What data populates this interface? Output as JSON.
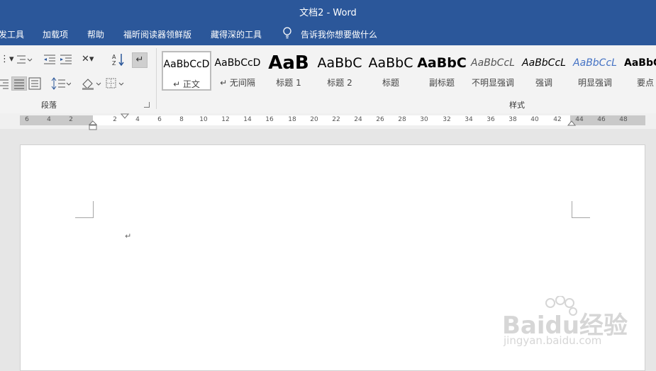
{
  "title": "文档2  -  Word",
  "menu": [
    "发工具",
    "加载项",
    "帮助",
    "福昕阅读器领鲜版",
    "藏得深的工具"
  ],
  "tell_me": "告诉我你想要做什么",
  "ribbon": {
    "paragraph_label": "段落",
    "styles_label": "样式",
    "styles": [
      {
        "sample": "AaBbCcD",
        "name": "↵ 正文"
      },
      {
        "sample": "AaBbCcD",
        "name": "↵ 无间隔"
      },
      {
        "sample": "AaB",
        "name": "标题 1"
      },
      {
        "sample": "AaBbC",
        "name": "标题 2"
      },
      {
        "sample": "AaBbC",
        "name": "标题"
      },
      {
        "sample": "AaBbC",
        "name": "副标题"
      },
      {
        "sample": "AaBbCcL",
        "name": "不明显强调"
      },
      {
        "sample": "AaBbCcL",
        "name": "强调"
      },
      {
        "sample": "AaBbCcL",
        "name": "明显强调"
      },
      {
        "sample": "AaBbC",
        "name": "要点"
      }
    ]
  },
  "ruler": {
    "left_nums": [
      "6",
      "4",
      "2"
    ],
    "right_nums": [
      "2",
      "4",
      "6",
      "8",
      "10",
      "12",
      "14",
      "16",
      "18",
      "20",
      "22",
      "24",
      "26",
      "28",
      "30",
      "32",
      "34",
      "36",
      "38",
      "40",
      "42",
      "44",
      "46",
      "48"
    ]
  },
  "document": {
    "paragraph_mark": "↵"
  },
  "watermark": {
    "brand": "Baidu经验",
    "url": "jingyan.baidu.com"
  }
}
